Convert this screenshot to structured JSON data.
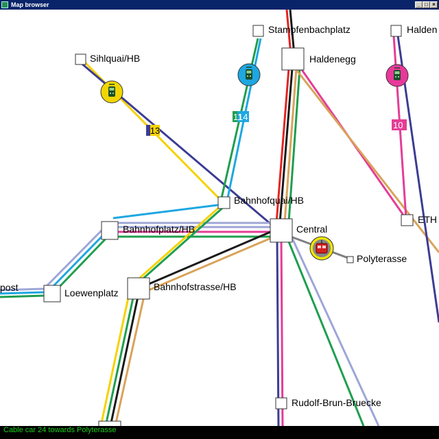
{
  "window": {
    "title": "Map browser",
    "buttons": [
      "_",
      "□",
      "×"
    ]
  },
  "stops": {
    "stampfenbachplatz": "Stampfenbachplatz",
    "haldenegg": "Haldenegg",
    "halden": "Halden",
    "sihlquai": "Sihlquai/HB",
    "bahnhofquai": "Bahnhofquai/HB",
    "bahnhofplatz": "Bahnhofplatz/HB",
    "central": "Central",
    "eth": "ETH",
    "polyterasse": "Polyterasse",
    "post": "post",
    "loewenplatz": "Loewenplatz",
    "bahnhofstrasse": "Bahnhofstrasse/HB",
    "rudolf": "Rudolf-Brun-Bruecke"
  },
  "route_badges": {
    "r13": "13",
    "r11": "11",
    "r14": "14",
    "r10": "10"
  },
  "vehicles": [
    {
      "type": "tram",
      "color": "#f2d500",
      "icon": "tram-icon"
    },
    {
      "type": "tram",
      "color": "#1ea7e1",
      "icon": "tram-icon"
    },
    {
      "type": "tram",
      "color": "#e9389a",
      "icon": "tram-icon"
    },
    {
      "type": "cable car",
      "color": "#f2e600",
      "icon": "cable-car-icon"
    }
  ],
  "status": {
    "text": "Cable car 24 towards Polyterasse"
  },
  "colors": {
    "yellow": "#f5d200",
    "navy": "#3c3c94",
    "green": "#1f9e4f",
    "blue": "#1ea7e1",
    "red": "#e32521",
    "black": "#1a1a1a",
    "orange": "#d9a35a",
    "pink": "#e43d96",
    "lavender": "#9ea6d6",
    "status_text": "#19d219"
  }
}
